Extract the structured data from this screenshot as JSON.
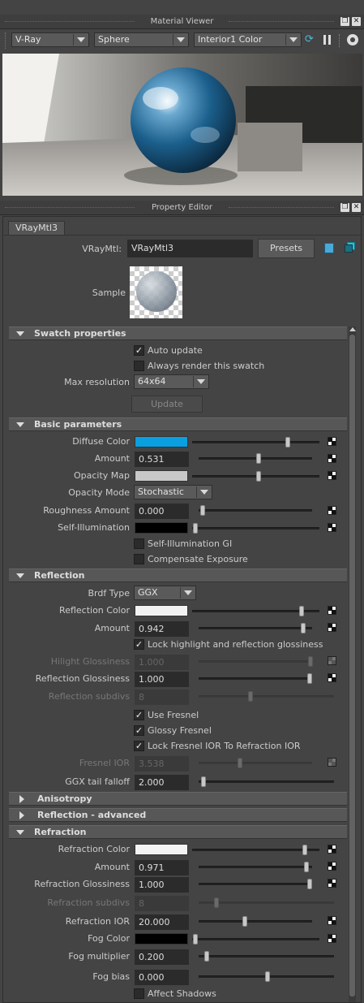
{
  "material_viewer": {
    "title": "Material Viewer",
    "renderer": "V-Ray",
    "shape": "Sphere",
    "environment": "Interior1 Color",
    "icons": [
      "refresh-icon",
      "pause-icon",
      "settings-icon",
      "float-icon",
      "close-icon"
    ]
  },
  "property_editor": {
    "title": "Property Editor",
    "tab": "VRayMtl3",
    "node_label": "VRayMtl:",
    "node_name": "VRayMtl3",
    "presets_label": "Presets",
    "sample_label": "Sample"
  },
  "swatch_properties": {
    "header": "Swatch properties",
    "auto_update": {
      "label": "Auto update",
      "checked": true
    },
    "always_render": {
      "label": "Always render this swatch",
      "checked": false
    },
    "max_res_label": "Max resolution",
    "max_res_value": "64x64",
    "update_label": "Update"
  },
  "basic": {
    "header": "Basic parameters",
    "diffuse_color": {
      "label": "Diffuse Color",
      "color": "#0a9fe0",
      "level": 0.81
    },
    "amount": {
      "label": "Amount",
      "value": "0.531",
      "level": 0.531
    },
    "opacity_map": {
      "label": "Opacity Map",
      "color": "#c8c8c8",
      "level": 0.52
    },
    "opacity_mode_label": "Opacity Mode",
    "opacity_mode_value": "Stochastic",
    "roughness": {
      "label": "Roughness Amount",
      "value": "0.000",
      "level": 0.0
    },
    "self_illum": {
      "label": "Self-Illumination",
      "color": "#000000",
      "level": 0.0
    },
    "self_illum_gi": {
      "label": "Self-Illumination GI",
      "checked": false
    },
    "compensate": {
      "label": "Compensate Exposure",
      "checked": false
    }
  },
  "reflection": {
    "header": "Reflection",
    "brdf_label": "Brdf Type",
    "brdf_value": "GGX",
    "reflection_color": {
      "label": "Reflection Color",
      "color": "#f2f2f2",
      "level": 0.95
    },
    "amount": {
      "label": "Amount",
      "value": "0.942",
      "level": 0.942
    },
    "lock_highlight": {
      "label": "Lock highlight and reflection glossiness",
      "checked": true
    },
    "hilight_gloss": {
      "label": "Hilight Glossiness",
      "value": "1.000",
      "level": 1.0
    },
    "refl_gloss": {
      "label": "Reflection Glossiness",
      "value": "1.000",
      "level": 1.0
    },
    "refl_subdivs": {
      "label": "Reflection subdivs",
      "value": "8",
      "level": 0.38
    },
    "use_fresnel": {
      "label": "Use Fresnel",
      "checked": true
    },
    "glossy_fresnel": {
      "label": "Glossy Fresnel",
      "checked": true
    },
    "lock_fresnel": {
      "label": "Lock Fresnel IOR To Refraction IOR",
      "checked": true
    },
    "fresnel_ior": {
      "label": "Fresnel IOR",
      "value": "3.538",
      "level": 0.36
    },
    "ggx_tail": {
      "label": "GGX tail falloff",
      "value": "2.000",
      "level": 0.0
    }
  },
  "anisotropy": {
    "header": "Anisotropy"
  },
  "reflection_adv": {
    "header": "Reflection - advanced"
  },
  "refraction": {
    "header": "Refraction",
    "refraction_color": {
      "label": "Refraction Color",
      "color": "#f4f4f4",
      "level": 0.97
    },
    "amount": {
      "label": "Amount",
      "value": "0.971",
      "level": 0.971
    },
    "refr_gloss": {
      "label": "Refraction Glossiness",
      "value": "1.000",
      "level": 1.0
    },
    "refr_subdivs": {
      "label": "Refraction subdivs",
      "value": "8",
      "level": 0.1
    },
    "refr_ior": {
      "label": "Refraction IOR",
      "value": "20.000",
      "level": 0.4
    },
    "fog_color": {
      "label": "Fog Color",
      "color": "#000000",
      "level": 0.0
    },
    "fog_mult": {
      "label": "Fog multiplier",
      "value": "0.200",
      "level": 0.04
    },
    "fog_bias": {
      "label": "Fog bias",
      "value": "0.000",
      "level": 0.5
    },
    "affect_shadows": {
      "label": "Affect Shadows",
      "checked": false
    }
  }
}
